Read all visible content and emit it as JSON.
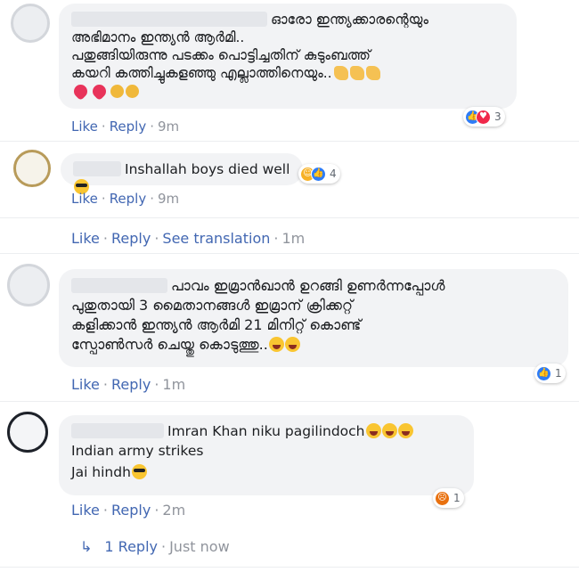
{
  "comments": [
    {
      "text_lines": [
        "ഓരോ ഇന്ത്യക്കാരന്റെയും",
        "അഭിമാനം ഇന്ത്യൻ ആർമി..",
        "പതുങ്ങിയിരുന്നു പടക്കം പൊട്ടിച്ചതിന് കുടുംബത്ത്",
        "കയറി കത്തിച്ചുകളഞ്ഞു എല്ലാത്തിനെയും.."
      ],
      "like": "Like",
      "reply": "Reply",
      "time": "9m",
      "reaction_count": "3"
    },
    {
      "text": "Inshallah boys died well",
      "like": "Like",
      "reply": "Reply",
      "time": "9m",
      "reaction_count": "4"
    },
    {
      "like": "Like",
      "reply": "Reply",
      "see_translation": "See translation",
      "time": "1m"
    },
    {
      "text_lines": [
        "പാവം ഇമ്രാൻഖാൻ ഉറങ്ങി ഉണർന്നപ്പോൾ",
        "പുതുതായി 3 മൈതാനങ്ങൾ ഇമ്രാന് ക്രിക്കറ്റ്",
        "കളിക്കാൻ ഇന്ത്യൻ ആർമി 21 മിനിറ്റ് കൊണ്ട്",
        "സ്പോൺസർ ചെയ്തു കൊടുത്തു.."
      ],
      "like": "Like",
      "reply": "Reply",
      "time": "1m",
      "reaction_count": "1"
    },
    {
      "text_lines": [
        "Imran Khan niku pagilindoch",
        "Indian army strikes",
        "Jai hindh"
      ],
      "like": "Like",
      "reply": "Reply",
      "time": "2m",
      "reaction_count": "1"
    }
  ],
  "replies_link": {
    "label": "1 Reply",
    "time": "Just now"
  },
  "colors": {
    "link": "#4267b2",
    "bubble": "#f2f3f5",
    "muted": "#90949c"
  }
}
